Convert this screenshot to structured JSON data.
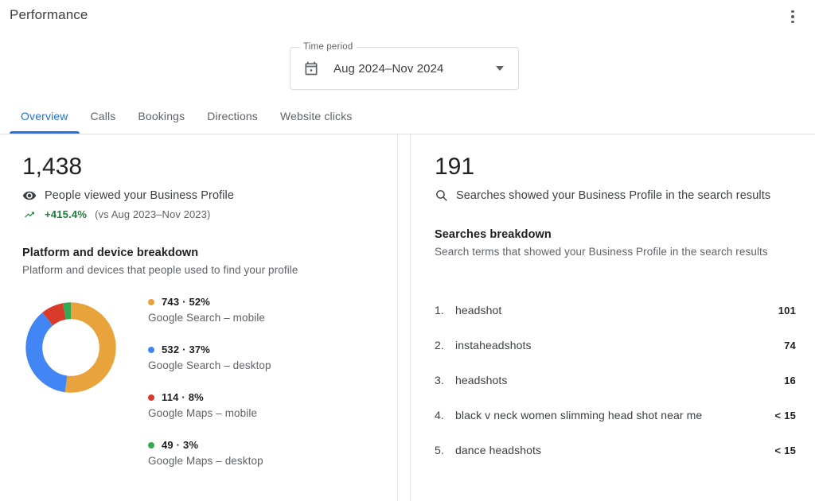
{
  "header": {
    "title": "Performance",
    "more_icon": "more-vert-icon"
  },
  "time_period": {
    "label": "Time period",
    "value": "Aug 2024–Nov 2024",
    "calendar_icon": "calendar-icon",
    "caret_icon": "chevron-down-icon"
  },
  "tabs": [
    {
      "label": "Overview",
      "active": true
    },
    {
      "label": "Calls",
      "active": false
    },
    {
      "label": "Bookings",
      "active": false
    },
    {
      "label": "Directions",
      "active": false
    },
    {
      "label": "Website clicks",
      "active": false
    }
  ],
  "views_panel": {
    "number": "1,438",
    "icon": "eye-icon",
    "label": "People viewed your Business Profile",
    "trend_icon": "trending-up-icon",
    "delta": "+415.4%",
    "comparison": "(vs Aug 2023–Nov 2023)",
    "section_title": "Platform and device breakdown",
    "section_subtitle": "Platform and devices that people used to find your profile"
  },
  "searches_panel": {
    "number": "191",
    "icon": "search-icon",
    "label": "Searches showed your Business Profile in the search results",
    "section_title": "Searches breakdown",
    "section_subtitle": "Search terms that showed your Business Profile in the search results"
  },
  "search_terms": [
    {
      "rank": "1.",
      "term": "headshot",
      "count": "101"
    },
    {
      "rank": "2.",
      "term": "instaheadshots",
      "count": "74"
    },
    {
      "rank": "3.",
      "term": "headshots",
      "count": "16"
    },
    {
      "rank": "4.",
      "term": "black v neck women slimming head shot near me",
      "count": "< 15"
    },
    {
      "rank": "5.",
      "term": "dance headshots",
      "count": "< 15"
    }
  ],
  "colors": {
    "accent_blue": "#1a73e8",
    "positive_green": "#188038",
    "segment_orange": "#e8a33d",
    "segment_blue": "#4285f4",
    "segment_red": "#d93b2b",
    "segment_green": "#34a853"
  },
  "chart_data": {
    "type": "pie",
    "title": "Platform and device breakdown",
    "subtitle": "Platform and devices that people used to find your profile",
    "total": 1438,
    "legend_position": "right",
    "categories": [
      "Google Search – mobile",
      "Google Search – desktop",
      "Google Maps – mobile",
      "Google Maps – desktop"
    ],
    "values": [
      743,
      532,
      114,
      49
    ],
    "percents": [
      52,
      37,
      8,
      3
    ],
    "colors": [
      "#e8a33d",
      "#4285f4",
      "#d93b2b",
      "#34a853"
    ],
    "labels": [
      "743 · 52%",
      "532 · 37%",
      "114 · 8%",
      "49 · 3%"
    ]
  }
}
